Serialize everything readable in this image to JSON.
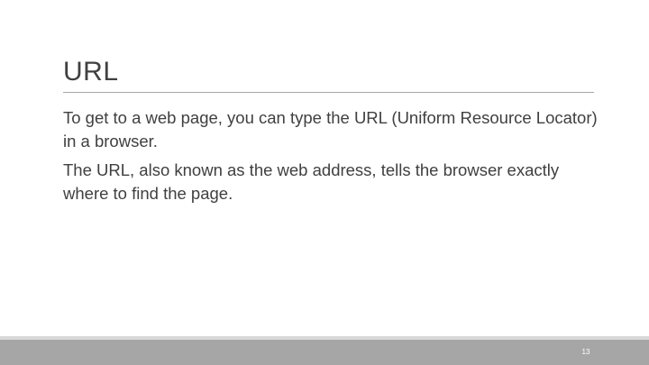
{
  "slide": {
    "title": "URL",
    "paragraphs": [
      "To get to a web page, you can type the URL (Uniform Resource Locator) in a browser.",
      "The URL, also known as the web address, tells the browser exactly where to find the page."
    ],
    "slide_number": "13"
  },
  "colors": {
    "text": "#404040",
    "rule": "#a6a6a6",
    "footer_bar": "#a6a6a6",
    "footer_stripe": "#d9d9d9",
    "background": "#ffffff"
  }
}
